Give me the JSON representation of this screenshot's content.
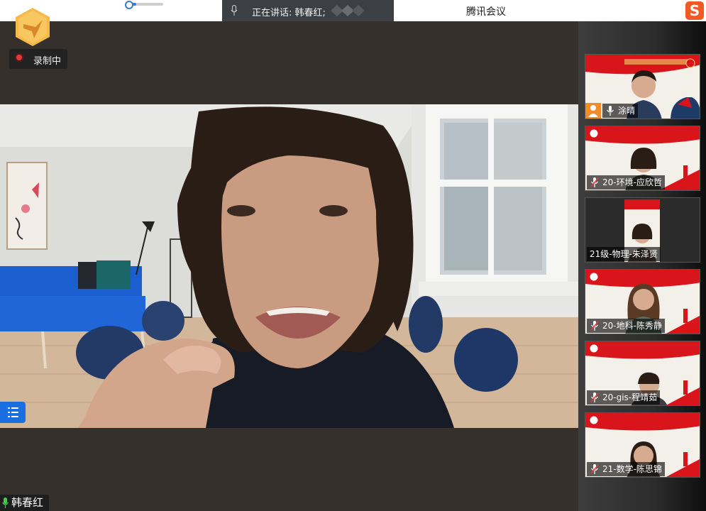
{
  "top_bar": {
    "speaking_label": "正在讲话: 韩春红;",
    "app_title": "腾讯会议",
    "ime_badge": "S",
    "volume_level": 0.2
  },
  "recording": {
    "label": "录制中"
  },
  "main_speaker": {
    "name": "韩春红"
  },
  "participants": [
    {
      "name": "涂晴",
      "icon": "host-person-icon"
    },
    {
      "name": "20-环境-应欣哲"
    },
    {
      "name": "21级-物理-朱泽贤"
    },
    {
      "name": "20-地科-陈秀静"
    },
    {
      "name": "20-gis-程靖茹"
    },
    {
      "name": "21-数学-陈思锦"
    }
  ],
  "colors": {
    "accent": "#1a6fe0",
    "record": "#e53935",
    "banner": "#d9151b"
  }
}
